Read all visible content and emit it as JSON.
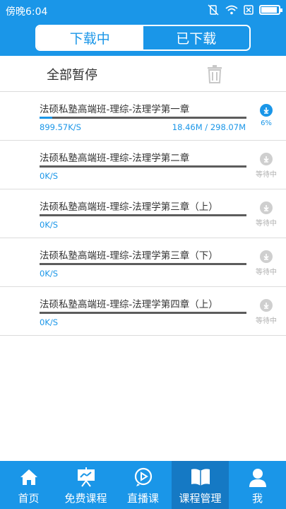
{
  "status_bar": {
    "time": "傍晚6:04"
  },
  "segmented": {
    "downloading_label": "下载中",
    "downloaded_label": "已下载"
  },
  "toolbar": {
    "pause_all_label": "全部暂停"
  },
  "downloads": [
    {
      "title": "法硕私塾高端班-理综-法理学第一章",
      "speed": "899.57K/S",
      "size": "18.46M / 298.07M",
      "status": "6%",
      "progress": 0.06,
      "state": "active"
    },
    {
      "title": "法硕私塾高端班-理综-法理学第二章",
      "speed": "0K/S",
      "size": "",
      "status": "等待中",
      "progress": 0,
      "state": "waiting"
    },
    {
      "title": "法硕私塾高端班-理综-法理学第三章（上）",
      "speed": "0K/S",
      "size": "",
      "status": "等待中",
      "progress": 0,
      "state": "waiting"
    },
    {
      "title": "法硕私塾高端班-理综-法理学第三章（下）",
      "speed": "0K/S",
      "size": "",
      "status": "等待中",
      "progress": 0,
      "state": "waiting"
    },
    {
      "title": "法硕私塾高端班-理综-法理学第四章（上）",
      "speed": "0K/S",
      "size": "",
      "status": "等待中",
      "progress": 0,
      "state": "waiting"
    }
  ],
  "tabbar": {
    "items": [
      {
        "label": "首页",
        "icon": "home-icon"
      },
      {
        "label": "免费课程",
        "icon": "presentation-icon"
      },
      {
        "label": "直播课",
        "icon": "play-icon"
      },
      {
        "label": "课程管理",
        "icon": "book-icon",
        "selected": true
      },
      {
        "label": "我",
        "icon": "person-icon"
      }
    ]
  },
  "colors": {
    "primary": "#1a96e8",
    "selected_tab": "#1579c4",
    "waiting_gray": "#b0b0b0"
  }
}
